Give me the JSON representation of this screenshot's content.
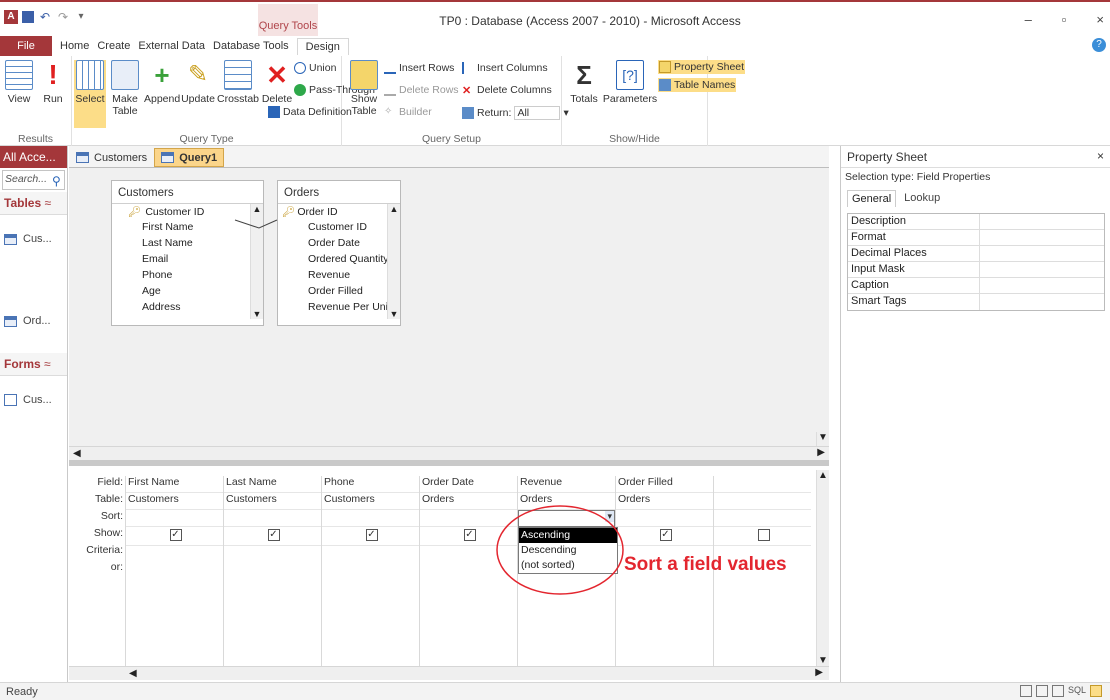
{
  "window": {
    "title": "TP0 : Database (Access 2007 - 2010) - Microsoft Access",
    "context_tab_group": "Query Tools",
    "minimize": "–",
    "restore": "▫",
    "close": "×",
    "help": "?"
  },
  "ribbon_tabs": {
    "file": "File",
    "home": "Home",
    "create": "Create",
    "external": "External Data",
    "dbtools": "Database Tools",
    "design": "Design"
  },
  "ribbon": {
    "results": {
      "label": "Results",
      "view": "View",
      "run": "Run"
    },
    "query_type": {
      "label": "Query Type",
      "select": "Select",
      "make_table_1": "Make",
      "make_table_2": "Table",
      "append": "Append",
      "update": "Update",
      "crosstab": "Crosstab",
      "delete": "Delete",
      "union": "Union",
      "pass_through": "Pass-Through",
      "data_definition": "Data Definition"
    },
    "query_setup": {
      "label": "Query Setup",
      "show_table_1": "Show",
      "show_table_2": "Table",
      "insert_rows": "Insert Rows",
      "delete_rows": "Delete Rows",
      "builder": "Builder",
      "insert_columns": "Insert Columns",
      "delete_columns": "Delete Columns",
      "return_label": "Return:",
      "return_value": "All"
    },
    "show_hide": {
      "label": "Show/Hide",
      "totals": "Totals",
      "parameters": "Parameters",
      "property_sheet": "Property Sheet",
      "table_names": "Table Names"
    }
  },
  "nav": {
    "header": "All Acce...",
    "search_placeholder": "Search...",
    "tables_group": "Tables",
    "tables": [
      "Cus...",
      "Ord..."
    ],
    "forms_group": "Forms",
    "forms": [
      "Cus..."
    ]
  },
  "doc_tabs": [
    {
      "label": "Customers"
    },
    {
      "label": "Query1"
    }
  ],
  "tables": {
    "customers": {
      "name": "Customers",
      "fields": [
        "Customer ID",
        "First Name",
        "Last Name",
        "Email",
        "Phone",
        "Age",
        "Address"
      ]
    },
    "orders": {
      "name": "Orders",
      "fields": [
        "Order ID",
        "Customer ID",
        "Order Date",
        "Ordered Quantity",
        "Revenue",
        "Order Filled",
        "Revenue Per Unit"
      ]
    }
  },
  "grid": {
    "row_labels": [
      "Field:",
      "Table:",
      "Sort:",
      "Show:",
      "Criteria:",
      "or:"
    ],
    "columns": [
      {
        "field": "First Name",
        "table": "Customers",
        "show": true
      },
      {
        "field": "Last Name",
        "table": "Customers",
        "show": true
      },
      {
        "field": "Phone",
        "table": "Customers",
        "show": true
      },
      {
        "field": "Order Date",
        "table": "Orders",
        "show": true
      },
      {
        "field": "Revenue",
        "table": "Orders",
        "show": true
      },
      {
        "field": "Order Filled",
        "table": "Orders",
        "show": true
      },
      {
        "field": "",
        "table": "",
        "show": false
      }
    ],
    "sort_options": [
      "Ascending",
      "Descending",
      "(not sorted)"
    ],
    "sort_selected": "Ascending"
  },
  "annotation": {
    "text": "Sort a field values",
    "color": "#e3262f"
  },
  "property_sheet": {
    "title": "Property Sheet",
    "selection_type": "Selection type: Field Properties",
    "tabs": [
      "General",
      "Lookup"
    ],
    "properties": [
      "Description",
      "Format",
      "Decimal Places",
      "Input Mask",
      "Caption",
      "Smart Tags"
    ]
  },
  "status": {
    "text": "Ready",
    "view_icons": "SQL"
  },
  "colors": {
    "brand": "#a4373a",
    "accent_tab": "#fbd58a"
  }
}
